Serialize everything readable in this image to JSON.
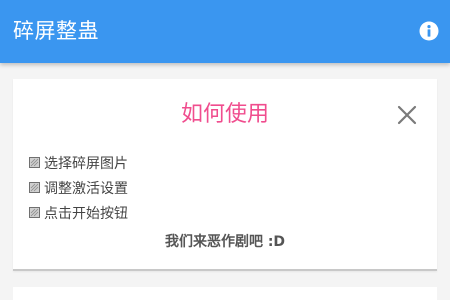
{
  "app_bar": {
    "title": "碎屏整蛊",
    "info_icon": "info-icon",
    "background_color": "#3a96f0"
  },
  "instructions_card": {
    "title": "如何使用",
    "title_color": "#f04d8e",
    "close_icon": "close-icon",
    "steps": [
      "选择碎屏图片",
      "调整激活设置",
      "点击开始按钮"
    ],
    "step_icon": "checkbox-pattern-icon",
    "footer": "我们来恶作剧吧 :D"
  }
}
